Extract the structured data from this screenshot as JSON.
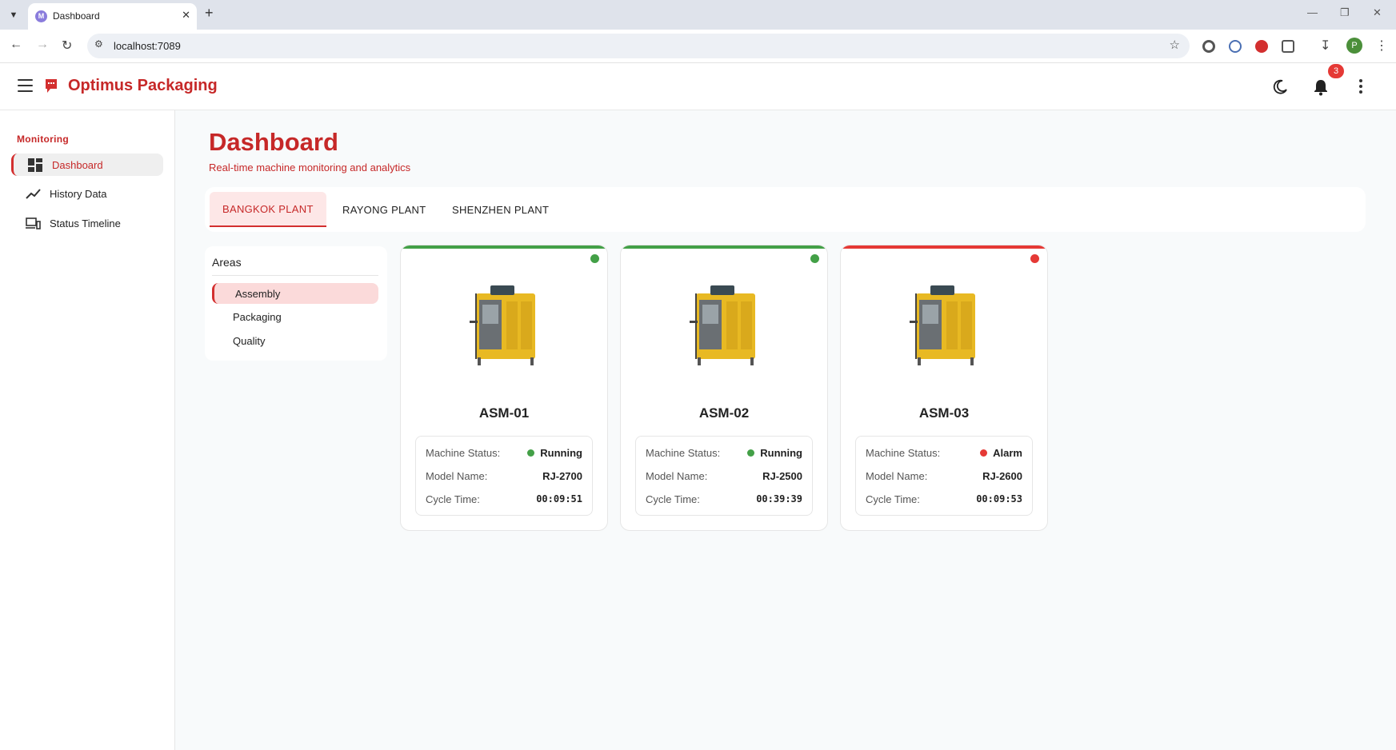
{
  "browser": {
    "tab_title": "Dashboard",
    "url": "localhost:7089",
    "profile_initial": "P"
  },
  "app": {
    "brand": "Optimus Packaging",
    "notification_count": "3"
  },
  "sidebar": {
    "section": "Monitoring",
    "items": [
      {
        "label": "Dashboard",
        "icon": "dashboard-icon",
        "active": true
      },
      {
        "label": "History Data",
        "icon": "trend-line-icon",
        "active": false
      },
      {
        "label": "Status Timeline",
        "icon": "devices-icon",
        "active": false
      }
    ]
  },
  "page": {
    "title": "Dashboard",
    "subtitle": "Real-time machine monitoring and analytics"
  },
  "plant_tabs": [
    "BANGKOK PLANT",
    "RAYONG PLANT",
    "SHENZHEN PLANT"
  ],
  "areas": {
    "title": "Areas",
    "items": [
      "Assembly",
      "Packaging",
      "Quality"
    ]
  },
  "labels": {
    "status": "Machine Status:",
    "model": "Model Name:",
    "cycle": "Cycle Time:"
  },
  "colors": {
    "accent": "#c62828",
    "running": "#43a047",
    "alarm": "#e53935"
  },
  "machines": [
    {
      "name": "ASM-01",
      "status": "Running",
      "model": "RJ-2700",
      "cycle_time": "00:09:51"
    },
    {
      "name": "ASM-02",
      "status": "Running",
      "model": "RJ-2500",
      "cycle_time": "00:39:39"
    },
    {
      "name": "ASM-03",
      "status": "Alarm",
      "model": "RJ-2600",
      "cycle_time": "00:09:53"
    }
  ]
}
